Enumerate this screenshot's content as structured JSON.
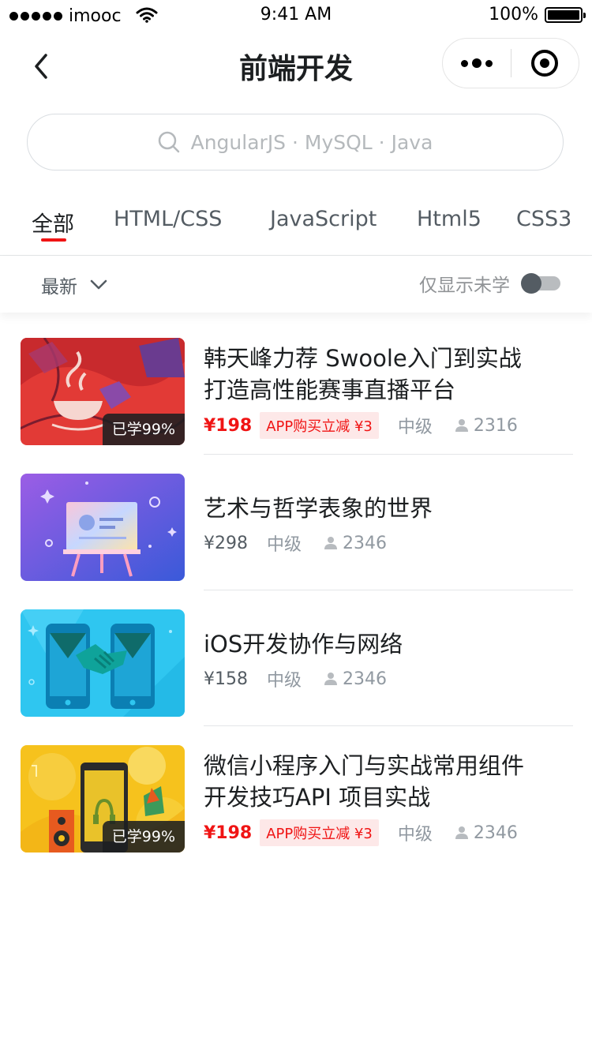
{
  "status_bar": {
    "carrier": "imooc",
    "time": "9:41 AM",
    "battery": "100%"
  },
  "nav": {
    "title": "前端开发"
  },
  "search": {
    "placeholder": "AngularJS · MySQL · Java"
  },
  "tabs": [
    {
      "label": "全部",
      "active": true
    },
    {
      "label": "HTML/CSS"
    },
    {
      "label": "JavaScript"
    },
    {
      "label": "Html5"
    },
    {
      "label": "CSS3"
    }
  ],
  "filter": {
    "sort_label": "最新",
    "only_unlearned_label": "仅显示未学",
    "only_unlearned_on": false
  },
  "courses": [
    {
      "title_line1": "韩天峰力荐 Swoole入门到实战",
      "title_line2": "打造高性能赛事直播平台",
      "price": "¥198",
      "promo": "APP购买立减 ¥3",
      "level": "中级",
      "students": "2316",
      "progress_badge": "已学99%"
    },
    {
      "title_line1": "艺术与哲学表象的世界",
      "price": "¥298",
      "level": "中级",
      "students": "2346"
    },
    {
      "title_line1": "iOS开发协作与网络",
      "price": "¥158",
      "level": "中级",
      "students": "2346"
    },
    {
      "title_line1": "微信小程序入门与实战常用组件",
      "title_line2": "开发技巧API  项目实战",
      "price": "¥198",
      "promo": "APP购买立减 ¥3",
      "level": "中级",
      "students": "2346",
      "progress_badge": "已学99%"
    }
  ],
  "colors": {
    "accent": "#f01414",
    "text_primary": "#1c1f21",
    "text_secondary": "#545c63"
  }
}
